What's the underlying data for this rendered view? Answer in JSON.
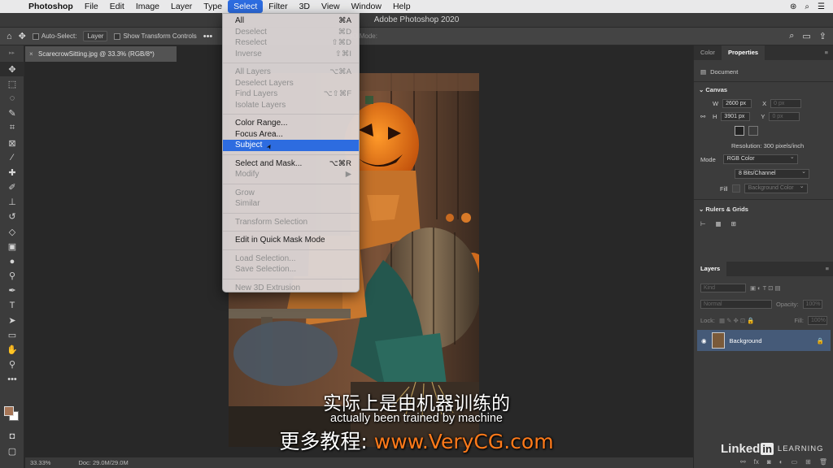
{
  "menubar": {
    "app": "Photoshop",
    "items": [
      "File",
      "Edit",
      "Image",
      "Layer",
      "Type",
      "Select",
      "Filter",
      "3D",
      "View",
      "Window",
      "Help"
    ],
    "active_item": "Select"
  },
  "window": {
    "title": "Adobe Photoshop 2020"
  },
  "options_bar": {
    "auto_select_label": "Auto-Select:",
    "auto_select_value": "Layer",
    "show_transform_label": "Show Transform Controls",
    "mode_3d_label": "3D Mode:"
  },
  "document": {
    "tab_title": "ScarecrowSitting.jpg @ 33.3% (RGB/8*)",
    "zoom": "33.33%",
    "doc_size": "Doc: 29.0M/29.0M"
  },
  "select_menu": {
    "items": [
      {
        "label": "All",
        "shortcut": "⌘A",
        "enabled": true
      },
      {
        "label": "Deselect",
        "shortcut": "⌘D",
        "enabled": false
      },
      {
        "label": "Reselect",
        "shortcut": "⇧⌘D",
        "enabled": false
      },
      {
        "label": "Inverse",
        "shortcut": "⇧⌘I",
        "enabled": false
      },
      {
        "sep": true
      },
      {
        "label": "All Layers",
        "shortcut": "⌥⌘A",
        "enabled": false
      },
      {
        "label": "Deselect Layers",
        "shortcut": "",
        "enabled": false
      },
      {
        "label": "Find Layers",
        "shortcut": "⌥⇧⌘F",
        "enabled": false
      },
      {
        "label": "Isolate Layers",
        "shortcut": "",
        "enabled": false
      },
      {
        "sep": true
      },
      {
        "label": "Color Range...",
        "shortcut": "",
        "enabled": true
      },
      {
        "label": "Focus Area...",
        "shortcut": "",
        "enabled": true
      },
      {
        "label": "Subject",
        "shortcut": "",
        "enabled": true,
        "highlighted": true
      },
      {
        "sep": true
      },
      {
        "label": "Select and Mask...",
        "shortcut": "⌥⌘R",
        "enabled": true
      },
      {
        "label": "Modify",
        "shortcut": "▶",
        "enabled": false
      },
      {
        "sep": true
      },
      {
        "label": "Grow",
        "shortcut": "",
        "enabled": false
      },
      {
        "label": "Similar",
        "shortcut": "",
        "enabled": false
      },
      {
        "sep": true
      },
      {
        "label": "Transform Selection",
        "shortcut": "",
        "enabled": false
      },
      {
        "sep": true
      },
      {
        "label": "Edit in Quick Mask Mode",
        "shortcut": "",
        "enabled": true
      },
      {
        "sep": true
      },
      {
        "label": "Load Selection...",
        "shortcut": "",
        "enabled": false
      },
      {
        "label": "Save Selection...",
        "shortcut": "",
        "enabled": false
      },
      {
        "sep": true
      },
      {
        "label": "New 3D Extrusion",
        "shortcut": "",
        "enabled": false
      }
    ]
  },
  "properties": {
    "tabs": [
      "Color",
      "Properties"
    ],
    "active_tab": "Properties",
    "doc_label": "Document",
    "canvas_title": "Canvas",
    "w_label": "W",
    "w_value": "2600 px",
    "h_label": "H",
    "h_value": "3901 px",
    "x_label": "X",
    "x_placeholder": "0 px",
    "y_label": "Y",
    "y_placeholder": "0 px",
    "resolution": "Resolution: 300 pixels/inch",
    "mode_label": "Mode",
    "mode_value": "RGB Color",
    "bits_value": "8 Bits/Channel",
    "fill_label": "Fill",
    "fill_value": "Background Color",
    "rulers_title": "Rulers & Grids"
  },
  "layers": {
    "title": "Layers",
    "kind_label": "Kind",
    "blend_mode": "Normal",
    "opacity_label": "Opacity:",
    "opacity_value": "100%",
    "lock_label": "Lock:",
    "fill_label": "Fill:",
    "fill_value": "100%",
    "layer_name": "Background"
  },
  "subtitles": {
    "zh": "实际上是由机器训练的",
    "en": "actually been trained by machine",
    "promo_prefix": "更多教程:",
    "promo_url": "www.VeryCG.com"
  },
  "watermark": {
    "brand": "Linked",
    "brand_in": "in",
    "suffix": "LEARNING"
  },
  "colors": {
    "menu_highlight": "#2d6ce0",
    "foreground_swatch": "#a67556",
    "background_swatch": "#ffffff",
    "layer_selected": "#455a78",
    "promo_url": "#ff7a1a"
  }
}
